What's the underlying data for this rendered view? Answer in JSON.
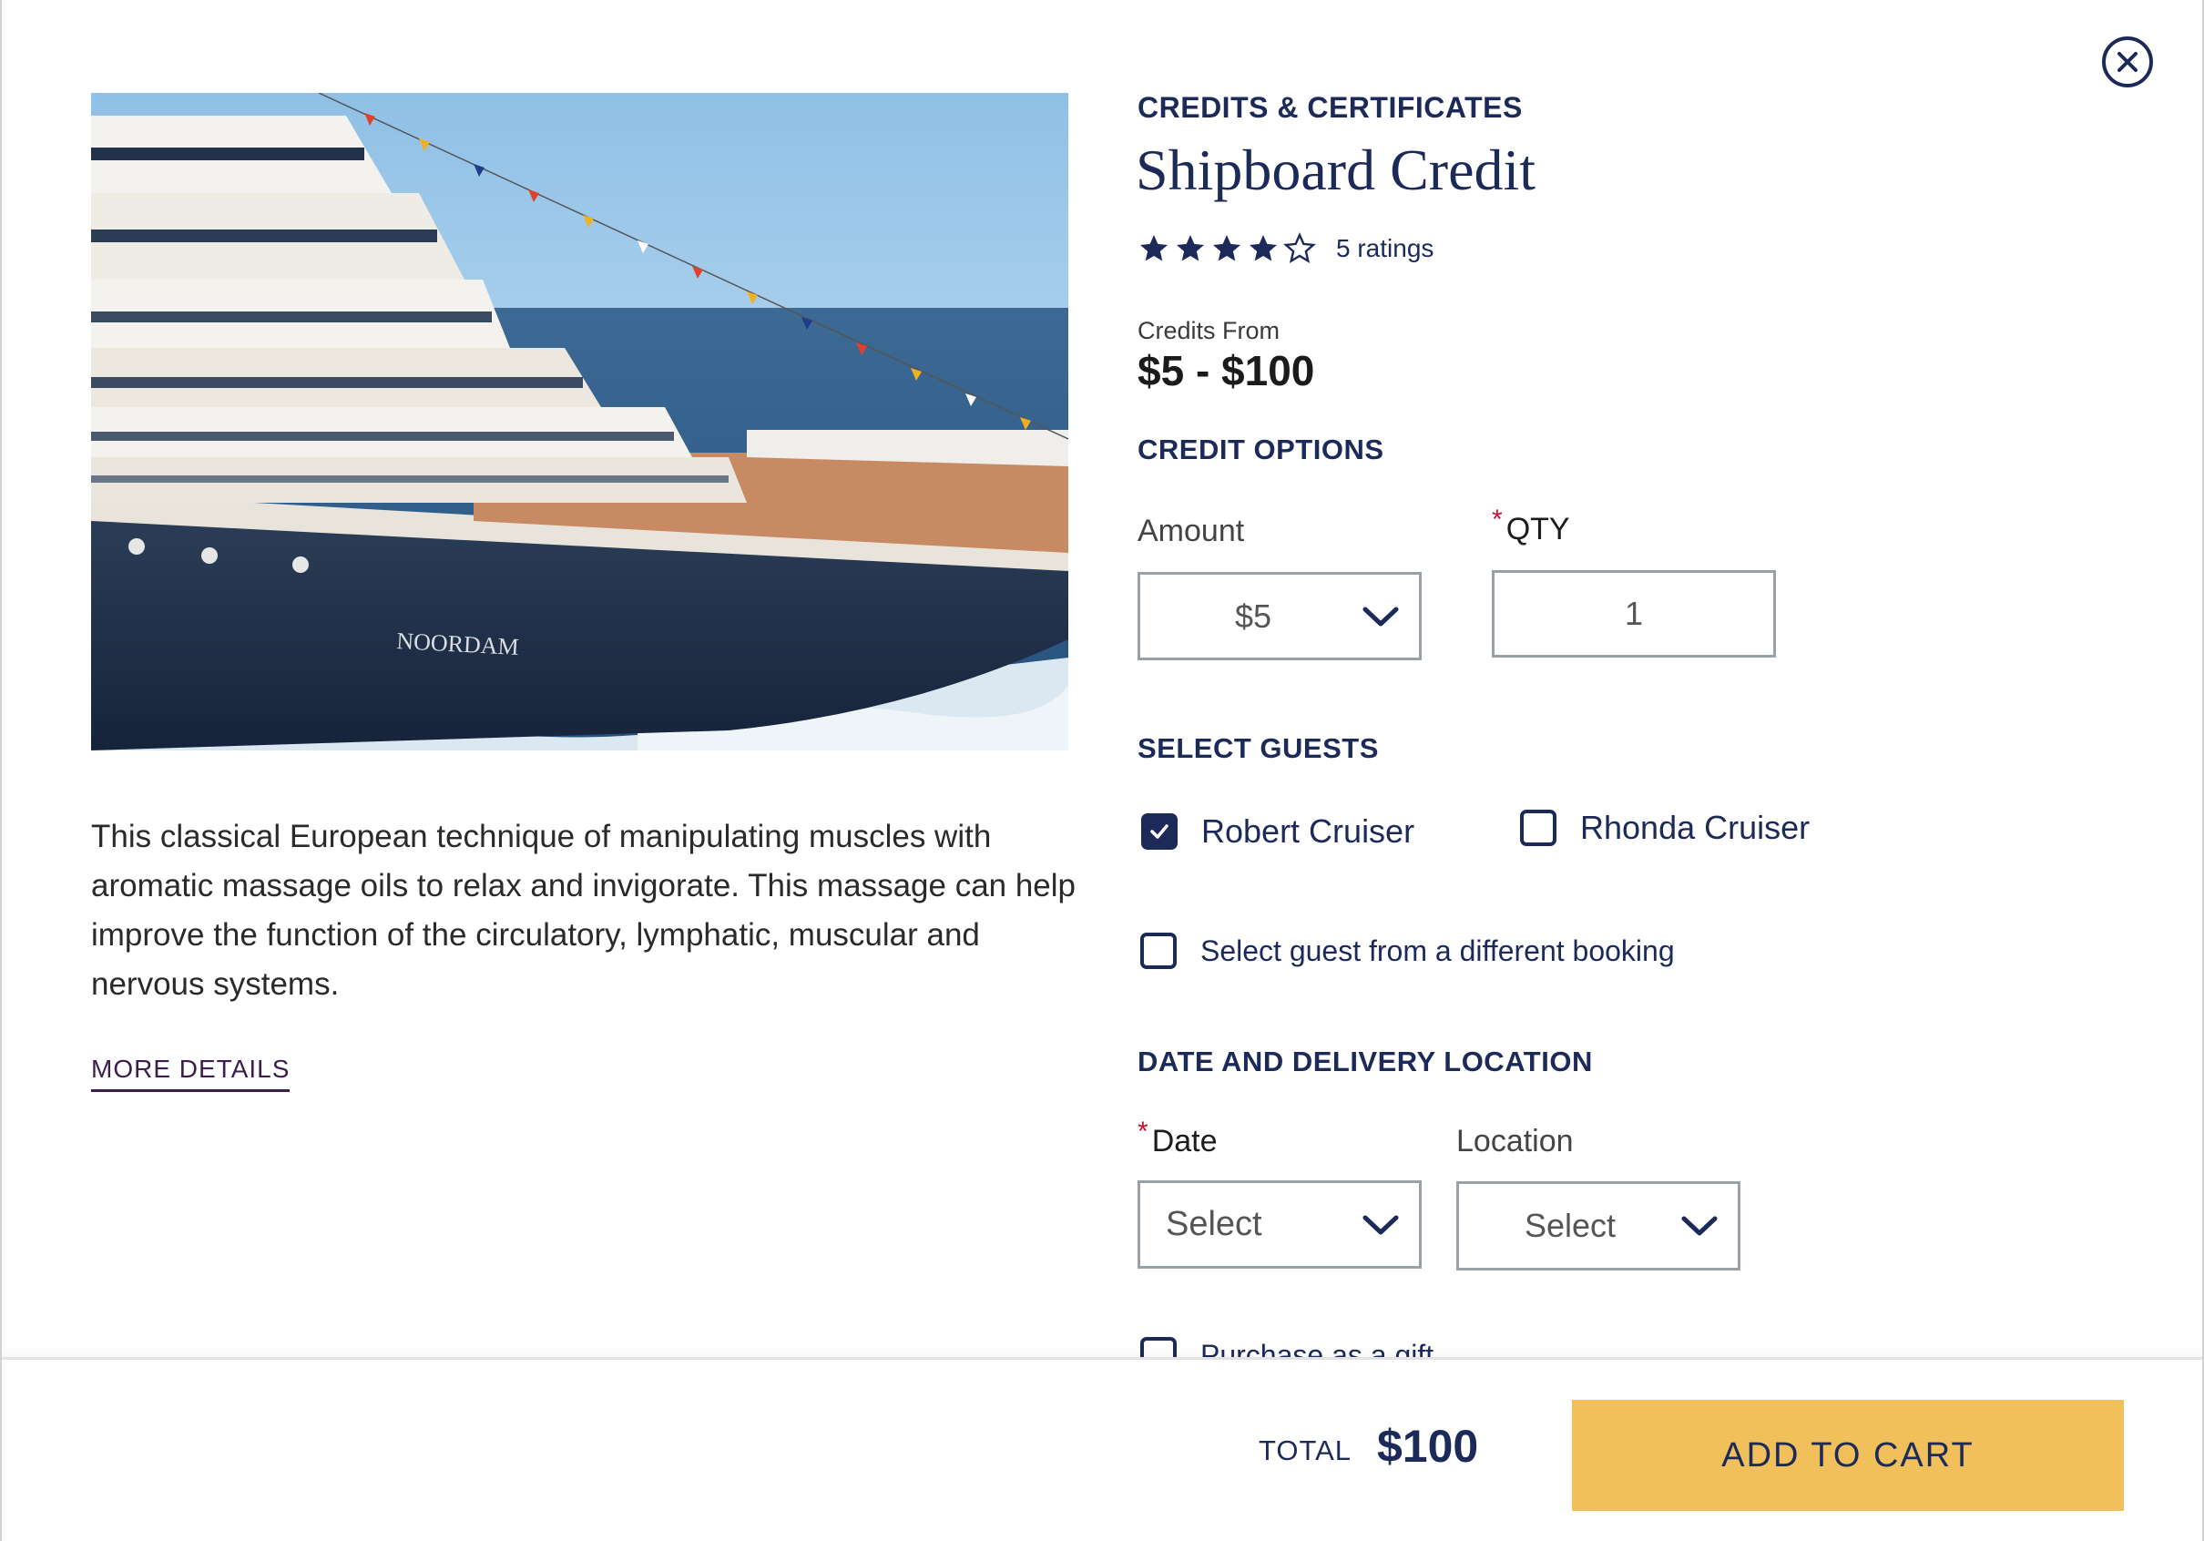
{
  "product": {
    "category": "CREDITS & CERTIFICATES",
    "title": "Shipboard Credit",
    "rating_stars": 4,
    "rating_max": 5,
    "rating_count": "5 ratings",
    "credits_from_label": "Credits From",
    "price_range": "$5 - $100",
    "description": "This classical European technique of manipulating muscles with aromatic massage oils to relax and invigorate. This massage can help improve the function of the circulatory, lymphatic, muscular and nervous systems.",
    "more_details": "MORE DETAILS",
    "ship_name": "NOORDAM"
  },
  "credit_options": {
    "heading": "CREDIT OPTIONS",
    "amount_label": "Amount",
    "amount_value": "$5",
    "qty_label": "QTY",
    "qty_value": "1"
  },
  "guests": {
    "heading": "SELECT GUESTS",
    "list": [
      {
        "name": "Robert Cruiser",
        "checked": true
      },
      {
        "name": "Rhonda Cruiser",
        "checked": false
      }
    ],
    "different_booking_label": "Select guest from a different booking"
  },
  "delivery": {
    "heading": "DATE AND DELIVERY LOCATION",
    "date_label": "Date",
    "date_value": "Select",
    "location_label": "Location",
    "location_value": "Select",
    "gift_label": "Purchase as a gift"
  },
  "footer": {
    "total_label": "TOTAL",
    "total_value": "$100",
    "add_to_cart": "ADD TO CART"
  },
  "icons": {
    "close": "close-icon",
    "star": "star-icon",
    "chevron": "chevron-down-icon",
    "check": "check-icon"
  },
  "colors": {
    "navy": "#1c2a5a",
    "gold": "#f2c05a",
    "required": "#c8102e"
  }
}
